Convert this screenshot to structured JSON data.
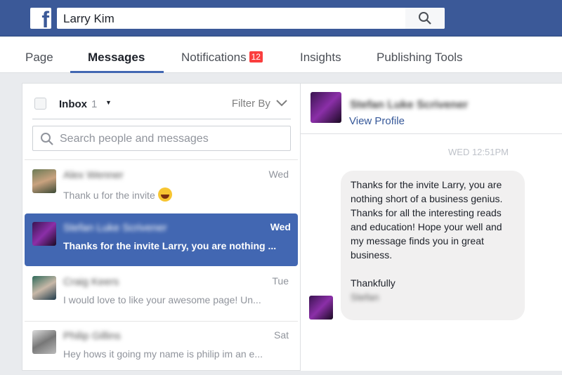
{
  "header": {
    "search_value": "Larry Kim",
    "logo": "f"
  },
  "tabs": [
    {
      "label": "Page"
    },
    {
      "label": "Messages",
      "active": true
    },
    {
      "label": "Notifications",
      "badge": "12"
    },
    {
      "label": "Insights"
    },
    {
      "label": "Publishing Tools"
    }
  ],
  "inbox": {
    "label": "Inbox",
    "count": "1",
    "filter_label": "Filter By",
    "search_placeholder": "Search people and messages"
  },
  "conversations": [
    {
      "name": "Alex Wenner",
      "time": "Wed",
      "snippet": "Thank u for the invite",
      "emoji": "grinning-face"
    },
    {
      "name": "Stefan Luke Scrivener",
      "time": "Wed",
      "snippet": "Thanks for the invite Larry, you are nothing ...",
      "selected": true
    },
    {
      "name": "Craig Keers",
      "time": "Tue",
      "snippet": "I would love to like your awesome page! Un..."
    },
    {
      "name": "Philip Gillins",
      "time": "Sat",
      "snippet": "Hey hows it going my name is philip im an e..."
    }
  ],
  "thread": {
    "name": "Stefan Luke Scrivener",
    "view_profile": "View Profile",
    "timestamp": "WED 12:51PM",
    "message": "Thanks for the invite Larry, you are nothing short of a business genius. Thanks for all the interesting reads and education! Hope your well and my message finds you in great business.\n\nThankfully\n",
    "signature": "Stefan"
  },
  "colors": {
    "brand": "#3b5998",
    "selected": "#4267b2",
    "badge": "#fa3e3e"
  }
}
